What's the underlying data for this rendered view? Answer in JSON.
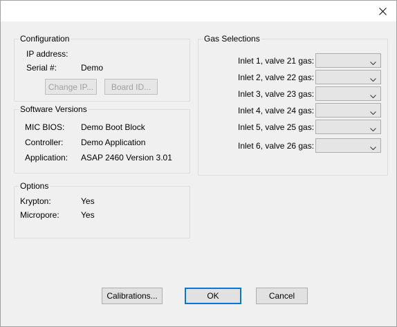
{
  "window": {
    "close_icon": "close-icon"
  },
  "configuration": {
    "title": "Configuration",
    "ip_label": "IP address:",
    "ip_value": "",
    "serial_label": "Serial #:",
    "serial_value": "Demo",
    "change_ip_button": "Change IP...",
    "board_id_button": "Board ID..."
  },
  "software_versions": {
    "title": "Software Versions",
    "rows": [
      {
        "label": "MIC BIOS:",
        "value": "Demo Boot Block"
      },
      {
        "label": "Controller:",
        "value": "Demo Application"
      },
      {
        "label": "Application:",
        "value": "ASAP 2460 Version 3.01"
      }
    ]
  },
  "options": {
    "title": "Options",
    "rows": [
      {
        "label": "Krypton:",
        "value": "Yes"
      },
      {
        "label": "Micropore:",
        "value": "Yes"
      }
    ]
  },
  "gas_selections": {
    "title": "Gas Selections",
    "inlets": [
      {
        "label": "Inlet 1, valve 21 gas:",
        "selected": ""
      },
      {
        "label": "Inlet 2, valve 22 gas:",
        "selected": ""
      },
      {
        "label": "Inlet 3, valve 23 gas:",
        "selected": ""
      },
      {
        "label": "Inlet 4, valve 24 gas:",
        "selected": ""
      },
      {
        "label": "Inlet 5, valve 25 gas:",
        "selected": ""
      },
      {
        "label": "Inlet 6, valve 26 gas:",
        "selected": ""
      }
    ]
  },
  "footer": {
    "calibrations_button": "Calibrations...",
    "ok_button": "OK",
    "cancel_button": "Cancel"
  },
  "colors": {
    "accent": "#0078d7",
    "window_bg": "#f0f0f0",
    "titlebar_bg": "#ffffff"
  }
}
